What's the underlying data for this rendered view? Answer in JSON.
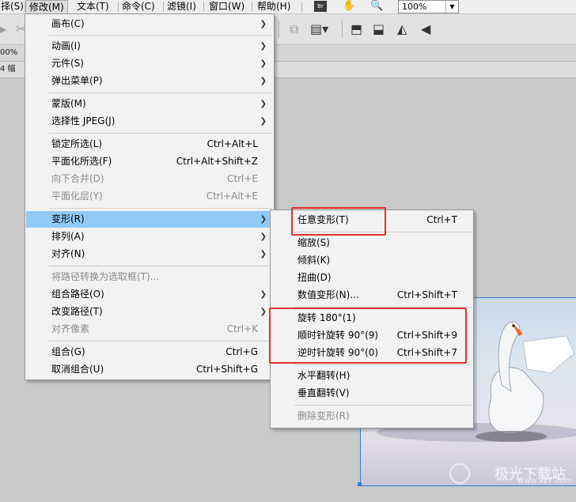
{
  "menubar": {
    "items": [
      "择(S)",
      "修改(M)",
      "文本(T)",
      "命令(C)",
      "滤镜(I)",
      "窗口(W)",
      "帮助(H)"
    ],
    "br_label": "Br",
    "zoom": "100%"
  },
  "options": {
    "frames_label": "4 幅",
    "zoom_left": "00%"
  },
  "modify_menu": {
    "items": [
      {
        "label": "画布(C)",
        "shortcut": "",
        "submenu": true,
        "disabled": false
      },
      {
        "label": "动画(I)",
        "shortcut": "",
        "submenu": true,
        "disabled": false
      },
      {
        "label": "元件(S)",
        "shortcut": "",
        "submenu": true,
        "disabled": false
      },
      {
        "label": "弹出菜单(P)",
        "shortcut": "",
        "submenu": true,
        "disabled": false
      },
      {
        "label": "蒙版(M)",
        "shortcut": "",
        "submenu": true,
        "disabled": false
      },
      {
        "label": "选择性 JPEG(J)",
        "shortcut": "",
        "submenu": true,
        "disabled": false
      },
      {
        "label": "锁定所选(L)",
        "shortcut": "Ctrl+Alt+L",
        "submenu": false,
        "disabled": false
      },
      {
        "label": "平面化所选(F)",
        "shortcut": "Ctrl+Alt+Shift+Z",
        "submenu": false,
        "disabled": false
      },
      {
        "label": "向下合并(D)",
        "shortcut": "Ctrl+E",
        "submenu": false,
        "disabled": true
      },
      {
        "label": "平面化层(Y)",
        "shortcut": "Ctrl+Alt+E",
        "submenu": false,
        "disabled": true
      },
      {
        "label": "变形(R)",
        "shortcut": "",
        "submenu": true,
        "disabled": false,
        "highlighted": true
      },
      {
        "label": "排列(A)",
        "shortcut": "",
        "submenu": true,
        "disabled": false
      },
      {
        "label": "对齐(N)",
        "shortcut": "",
        "submenu": true,
        "disabled": false
      },
      {
        "label": "将路径转换为选取框(T)...",
        "shortcut": "",
        "submenu": false,
        "disabled": true
      },
      {
        "label": "组合路径(O)",
        "shortcut": "",
        "submenu": true,
        "disabled": false
      },
      {
        "label": "改变路径(T)",
        "shortcut": "",
        "submenu": true,
        "disabled": false
      },
      {
        "label": "对齐像素",
        "shortcut": "Ctrl+K",
        "submenu": false,
        "disabled": true
      },
      {
        "label": "组合(G)",
        "shortcut": "Ctrl+G",
        "submenu": false,
        "disabled": false
      },
      {
        "label": "取消组合(U)",
        "shortcut": "Ctrl+Shift+G",
        "submenu": false,
        "disabled": false
      }
    ]
  },
  "transform_menu": {
    "items": [
      {
        "label": "任意变形(T)",
        "shortcut": "Ctrl+T",
        "disabled": false
      },
      {
        "label": "缩放(S)",
        "shortcut": "",
        "disabled": false
      },
      {
        "label": "倾斜(K)",
        "shortcut": "",
        "disabled": false
      },
      {
        "label": "扭曲(D)",
        "shortcut": "",
        "disabled": false
      },
      {
        "label": "数值变形(N)...",
        "shortcut": "Ctrl+Shift+T",
        "disabled": false
      },
      {
        "label": "旋转 180°(1)",
        "shortcut": "",
        "disabled": false
      },
      {
        "label": "顺时针旋转 90°(9)",
        "shortcut": "Ctrl+Shift+9",
        "disabled": false
      },
      {
        "label": "逆时针旋转 90°(0)",
        "shortcut": "Ctrl+Shift+7",
        "disabled": false
      },
      {
        "label": "水平翻转(H)",
        "shortcut": "",
        "disabled": false
      },
      {
        "label": "垂直翻转(V)",
        "shortcut": "",
        "disabled": false
      },
      {
        "label": "删除变形(R)",
        "shortcut": "",
        "disabled": true
      }
    ]
  },
  "watermark": {
    "text": "极光下载站",
    "url": "www.xz7.com"
  },
  "colors": {
    "highlight": "#91c9f7",
    "annotation_red": "#e03030",
    "selection_blue": "#2d7dd2"
  }
}
